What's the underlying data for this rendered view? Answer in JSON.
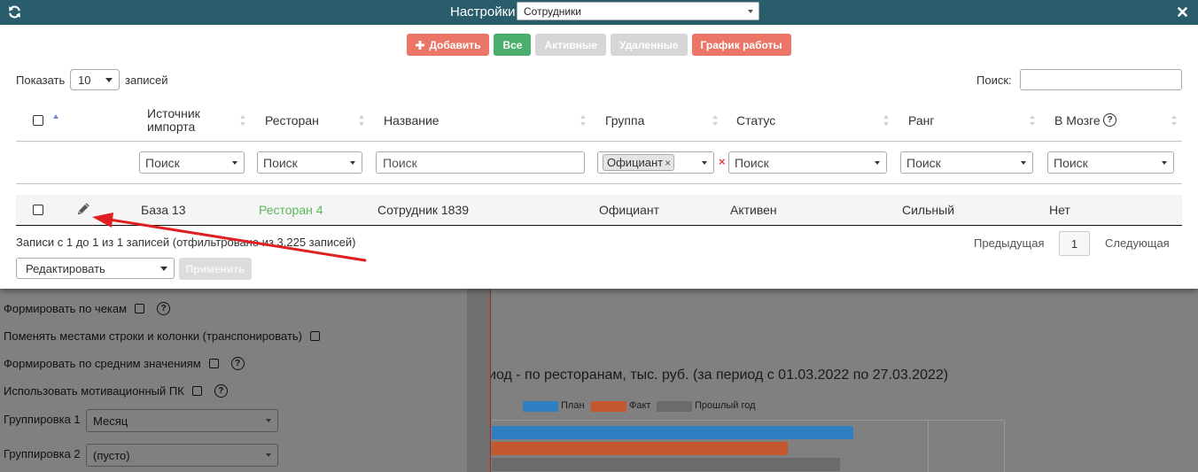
{
  "window": {
    "title": "Настройки",
    "entity": "Сотрудники"
  },
  "icons": {
    "refresh": "refresh-icon",
    "close": "close-icon",
    "add": "plus-icon",
    "edit": "pencil-icon",
    "help": "question-circle-icon",
    "remove_tag": "tag-remove-icon",
    "clear": "clear-icon"
  },
  "colors": {
    "titlebar": "#2a5d6c",
    "add": "#eb7668",
    "all": "#4cae6c",
    "inactive": "#d6d6d6",
    "schedule": "#eb7668",
    "restaurant_link": "#5cb85c",
    "annotation": "#e02020"
  },
  "toolbar": {
    "add": "Добавить",
    "all": "Все",
    "active": "Активные",
    "deleted": "Удаленные",
    "schedule": "График работы"
  },
  "page_length": {
    "prefix": "Показать",
    "value": "10",
    "suffix": "записей"
  },
  "search": {
    "label": "Поиск:",
    "value": ""
  },
  "table": {
    "columns": [
      "Источник импорта",
      "Ресторан",
      "Название",
      "Группа",
      "Статус",
      "Ранг",
      "В Мозге"
    ],
    "filter_placeholder": "Поиск",
    "group_filter_tag": "Официант",
    "rows": [
      {
        "checked": false,
        "source": "База 13",
        "restaurant": "Ресторан 4",
        "name": "Сотрудник 1839",
        "group": "Официант",
        "status": "Активен",
        "rank": "Сильный",
        "in_brain": "Нет"
      }
    ]
  },
  "info": "Записи с 1 до 1 из 1 записей (отфильтровано из 3,225 записей)",
  "pagination": {
    "previous": "Предыдущая",
    "current": "1",
    "next": "Следующая"
  },
  "bulk_action": {
    "selected": "Редактировать",
    "apply": "Применить"
  },
  "background": {
    "options": [
      {
        "label": "Формировать по чекам",
        "checked": false
      },
      {
        "label": "Поменять местами строки и колонки (транспонировать)",
        "checked": false
      },
      {
        "label": "Формировать по средним значениям",
        "checked": false
      },
      {
        "label": "Использовать мотивационный ПК",
        "checked": false
      }
    ],
    "grouping": [
      {
        "label": "Группировка 1",
        "value": "Месяц"
      },
      {
        "label": "Группировка 2",
        "value": "(пусто)"
      }
    ],
    "chart": {
      "title": "иод - по ресторанам, тыс. руб. (за период с 01.03.2022 по 27.03.2022)",
      "legend": [
        {
          "name": "План",
          "color": "#2f7fc2"
        },
        {
          "name": "Факт",
          "color": "#c5572f"
        },
        {
          "name": "Прошлый год",
          "color": "#6b6b6b"
        }
      ]
    }
  }
}
